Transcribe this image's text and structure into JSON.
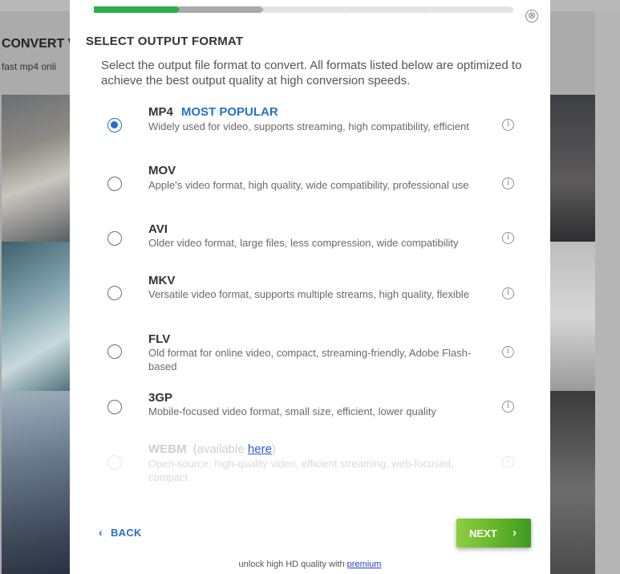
{
  "background": {
    "heading": "CONVERT V",
    "subheading": "fast mp4 onli"
  },
  "modal": {
    "close_icon": "⊗",
    "title": "SELECT OUTPUT FORMAT",
    "description": "Select the output file format to convert. All formats listed below are optimized to achieve the best output quality at high conversion speeds.",
    "progress": {
      "total_steps": 5,
      "completed_steps": 1,
      "current_step": 2
    },
    "options": [
      {
        "name": "MP4",
        "badge": "MOST POPULAR",
        "description": "Widely used for video, supports streaming, high compatibility, efficient",
        "selected": true,
        "disabled": false
      },
      {
        "name": "MOV",
        "description": "Apple's video format, high quality, wide compatibility, professional use",
        "selected": false,
        "disabled": false
      },
      {
        "name": "AVI",
        "description": "Older video format, large files, less compression, wide compatibility",
        "selected": false,
        "disabled": false
      },
      {
        "name": "MKV",
        "description": "Versatile video format, supports multiple streams, high quality, flexible",
        "selected": false,
        "disabled": false
      },
      {
        "name": "FLV",
        "description": "Old format for online video, compact, streaming-friendly, Adobe Flash-based",
        "selected": false,
        "disabled": false
      },
      {
        "name": "3GP",
        "description": "Mobile-focused video format, small size, efficient, lower quality",
        "selected": false,
        "disabled": false
      },
      {
        "name": "WEBM",
        "availability_prefix": "(available",
        "availability_link": "here",
        "availability_suffix": ")",
        "description": "Open-source, high-quality video, efficient streaming, web-focused, compact",
        "selected": false,
        "disabled": true
      }
    ],
    "back_label": "BACK",
    "next_label": "NEXT",
    "chevron_left": "‹",
    "chevron_right": "›",
    "info_icon": "i",
    "footer_text": "unlock high HD quality with",
    "footer_link": "premium"
  },
  "colors": {
    "accent_blue": "#2472c8",
    "progress_green": "#2fae4e",
    "next_green": "#5fb12a"
  }
}
